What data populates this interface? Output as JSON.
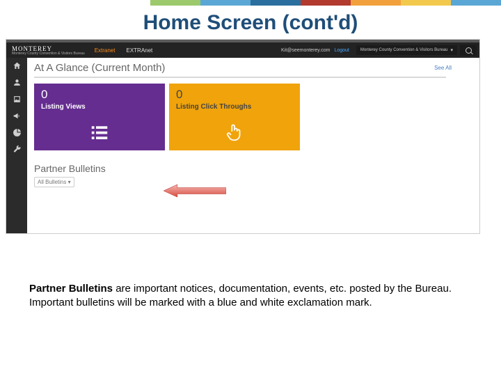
{
  "stripe_colors": [
    "#ffffff",
    "#ffffff",
    "#ffffff",
    "#9cc96b",
    "#5aa7d6",
    "#2a6f9e",
    "#b23a2e",
    "#f2a03d",
    "#f2c94c",
    "#5aa7d6"
  ],
  "slide_title": "Home Screen (cont'd)",
  "brand": {
    "name": "MONTEREY",
    "sub": "Monterey County Convention & Visitors Bureau"
  },
  "nav": {
    "extranet_orange": "Extranet",
    "extranet_white": "EXTRAnet",
    "email": "Kit@seemonterey.com",
    "logout": "Logout",
    "org": "Monterey County Convention & Visitors Bureau"
  },
  "glance": {
    "title": "At A Glance (Current Month)",
    "see_all": "See All"
  },
  "cards": [
    {
      "value": "0",
      "label": "Listing Views"
    },
    {
      "value": "0",
      "label": "Listing Click Throughs"
    }
  ],
  "partner_bulletins": {
    "title": "Partner Bulletins",
    "filter": "All Bulletins"
  },
  "caption": {
    "bold": "Partner Bulletins",
    "rest": " are important notices, documentation, events, etc. posted by the Bureau. Important bulletins will be marked with a blue and white exclamation mark."
  }
}
